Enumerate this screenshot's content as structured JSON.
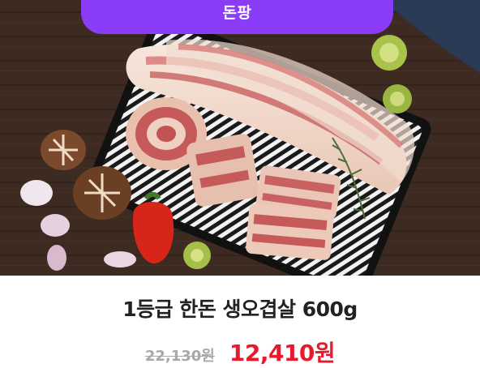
{
  "badge": {
    "label": "돈팡",
    "color": "#8b3cf6"
  },
  "product": {
    "image_alt": "pork-belly-photo",
    "name": "1등급 한돈 생오겹살 600g",
    "original_price": "22,130원",
    "sale_price": "12,410원",
    "sale_color": "#e8192c"
  }
}
